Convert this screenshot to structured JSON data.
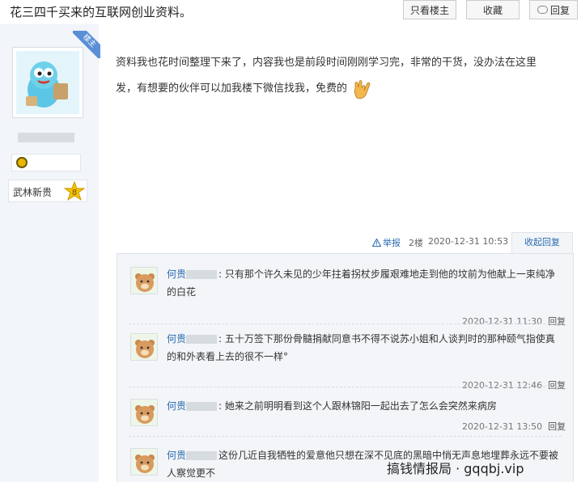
{
  "thread": {
    "title": "花三四千买来的互联网创业资料。",
    "only_author_label": "只看楼主",
    "favorite_label": "收藏",
    "reply_label": "回复"
  },
  "poster": {
    "badge": "楼主",
    "rank_title": "武林新贵",
    "level": "8"
  },
  "post": {
    "line1": "资料我也花时间整理下来了，内容我也是前段时间刚刚学习完，非常的干货，没办法在这里",
    "line2": "发，有想要的伙伴可以加我楼下微信找我，免费的",
    "report_label": "举报",
    "floor": "2楼",
    "time": "2020-12-31 10:53",
    "collapse_label": "收起回复"
  },
  "comments": [
    {
      "name": "何贵",
      "text": ": 只有那个许久未见的少年拄着拐杖步履艰难地走到他的坟前为他献上一束纯净的白花",
      "time": "2020-12-31 11:30",
      "reply_label": "回复"
    },
    {
      "name": "何贵",
      "text": ": 五十万签下那份骨髓捐献同意书不得不说苏小姐和人谈判时的那种颐气指使真的和外表看上去的很不一样°",
      "time": "2020-12-31 12:46",
      "reply_label": "回复"
    },
    {
      "name": "何贵",
      "text": ": 她来之前明明看到这个人跟林锦阳一起出去了怎么会突然来病房",
      "time": "2020-12-31 13:50",
      "reply_label": "回复"
    },
    {
      "name": "何贵",
      "text": "这份几近自我牺牲的爱意他只想在深不见底的黑暗中悄无声息地埋葬永远不要被人察觉更不",
      "time": "",
      "reply_label": ""
    }
  ],
  "watermark": "搞钱情报局 · gqqbj.vip",
  "colors": {
    "accent_blue": "#2a6bb0",
    "panel_bg": "#f2f6fa",
    "comments_bg": "#f3f5f8"
  }
}
